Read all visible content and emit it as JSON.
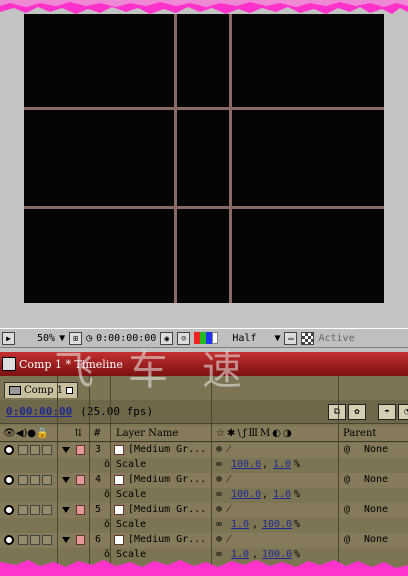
{
  "viewer": {
    "zoom": "50%",
    "timecode": "0:00:00:00",
    "resolution": "Half",
    "camera": "Active"
  },
  "timeline_window": {
    "title": "Comp 1 * Timeline"
  },
  "tab": {
    "label": "Comp 1"
  },
  "time_row": {
    "current_time": "0:00:00:00",
    "fps": "(25.00 fps)"
  },
  "columns": {
    "number": "#",
    "layer_name": "Layer Name",
    "switches": "☆✱\\ƒⅢM◐◑",
    "parent": "Parent"
  },
  "layers": [
    {
      "number": "3",
      "name": "[Medium Gr...",
      "parent": "None",
      "prop_label": "Scale",
      "value_a": "100.0",
      "value_b": "1.0",
      "unit": "%"
    },
    {
      "number": "4",
      "name": "[Medium Gr...",
      "parent": "None",
      "prop_label": "Scale",
      "value_a": "100.0",
      "value_b": "1.0",
      "unit": "%"
    },
    {
      "number": "5",
      "name": "[Medium Gr...",
      "parent": "None",
      "prop_label": "Scale",
      "value_a": "1.0",
      "value_b": "100.0",
      "unit": "%"
    },
    {
      "number": "6",
      "name": "[Medium Gr...",
      "parent": "None",
      "prop_label": "Scale",
      "value_a": "1.0",
      "value_b": "100.0",
      "unit": "%"
    }
  ],
  "watermark": {
    "text": "飞车速"
  },
  "colors": {
    "torn_edge": "#ff33cc",
    "gridline": "#8a6a66",
    "title_bar": "#a82020",
    "timeline_bg": "#7d7454",
    "label_color": "#e49a9a"
  }
}
